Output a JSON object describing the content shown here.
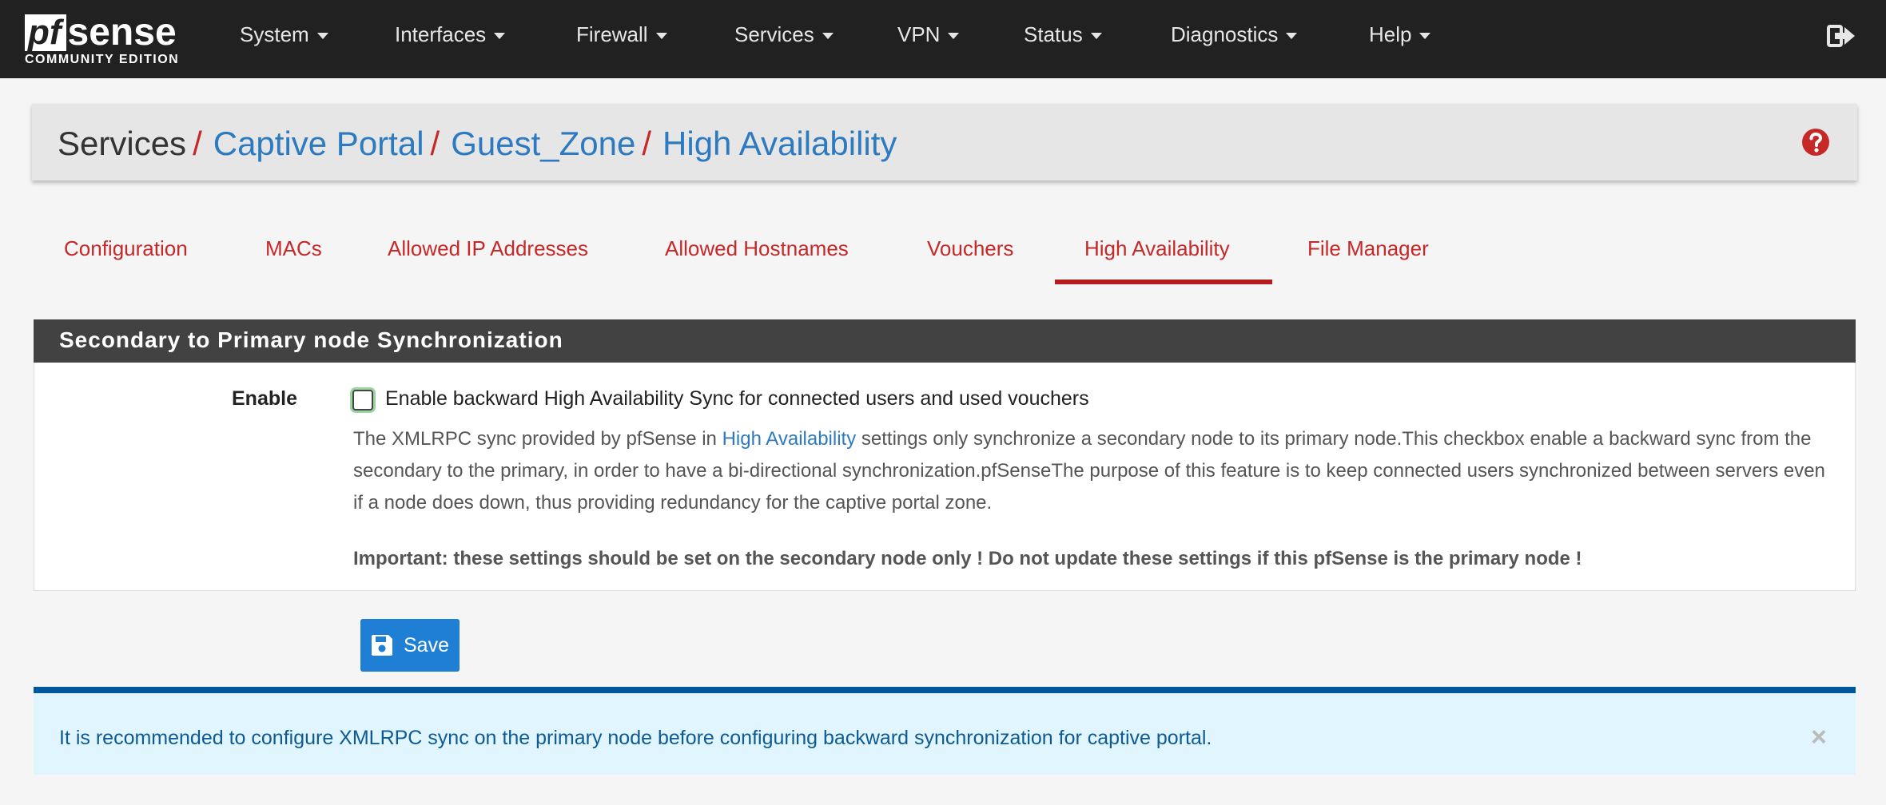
{
  "brand": {
    "name_pf": "pf",
    "name_rest": "sense",
    "edition": "COMMUNITY EDITION"
  },
  "nav": {
    "items": [
      "System",
      "Interfaces",
      "Firewall",
      "Services",
      "VPN",
      "Status",
      "Diagnostics",
      "Help"
    ],
    "logout_icon": "sign-out-icon"
  },
  "breadcrumb": {
    "root": "Services",
    "links": [
      "Captive Portal",
      "Guest_Zone",
      "High Availability"
    ],
    "separator": "/",
    "help_icon": "question-circle-icon"
  },
  "tabs": {
    "items": [
      "Configuration",
      "MACs",
      "Allowed IP Addresses",
      "Allowed Hostnames",
      "Vouchers",
      "High Availability",
      "File Manager"
    ],
    "active": "High Availability"
  },
  "panel": {
    "heading": "Secondary to Primary node Synchronization",
    "enable_label": "Enable",
    "checkbox_label": "Enable backward High Availability Sync for connected users and used vouchers",
    "checkbox_checked": false,
    "help_part1": "The XMLRPC sync provided by pfSense in ",
    "help_link": "High Availability",
    "help_part2": " settings only synchronize a secondary node to its primary node.This checkbox enable a backward sync from the secondary to the primary, in order to have a bi-directional synchronization.pfSenseThe purpose of this feature is to keep connected users synchronized between servers even if a node does down, thus providing redundancy for the captive portal zone.",
    "important": "Important: these settings should be set on the secondary node only ! Do not update these settings if this pfSense is the primary node !"
  },
  "save": {
    "label": "Save",
    "icon": "floppy-disk-icon"
  },
  "alert": {
    "text": "It is recommended to configure XMLRPC sync on the primary node before configuring backward synchronization for captive portal.",
    "close": "×"
  },
  "colors": {
    "navbar": "#212121",
    "accent_red": "#c62828",
    "link_blue": "#2d7ac0",
    "button_blue": "#1e7fd4",
    "alert_border": "#01579b",
    "alert_bg": "#e1f5fe"
  }
}
